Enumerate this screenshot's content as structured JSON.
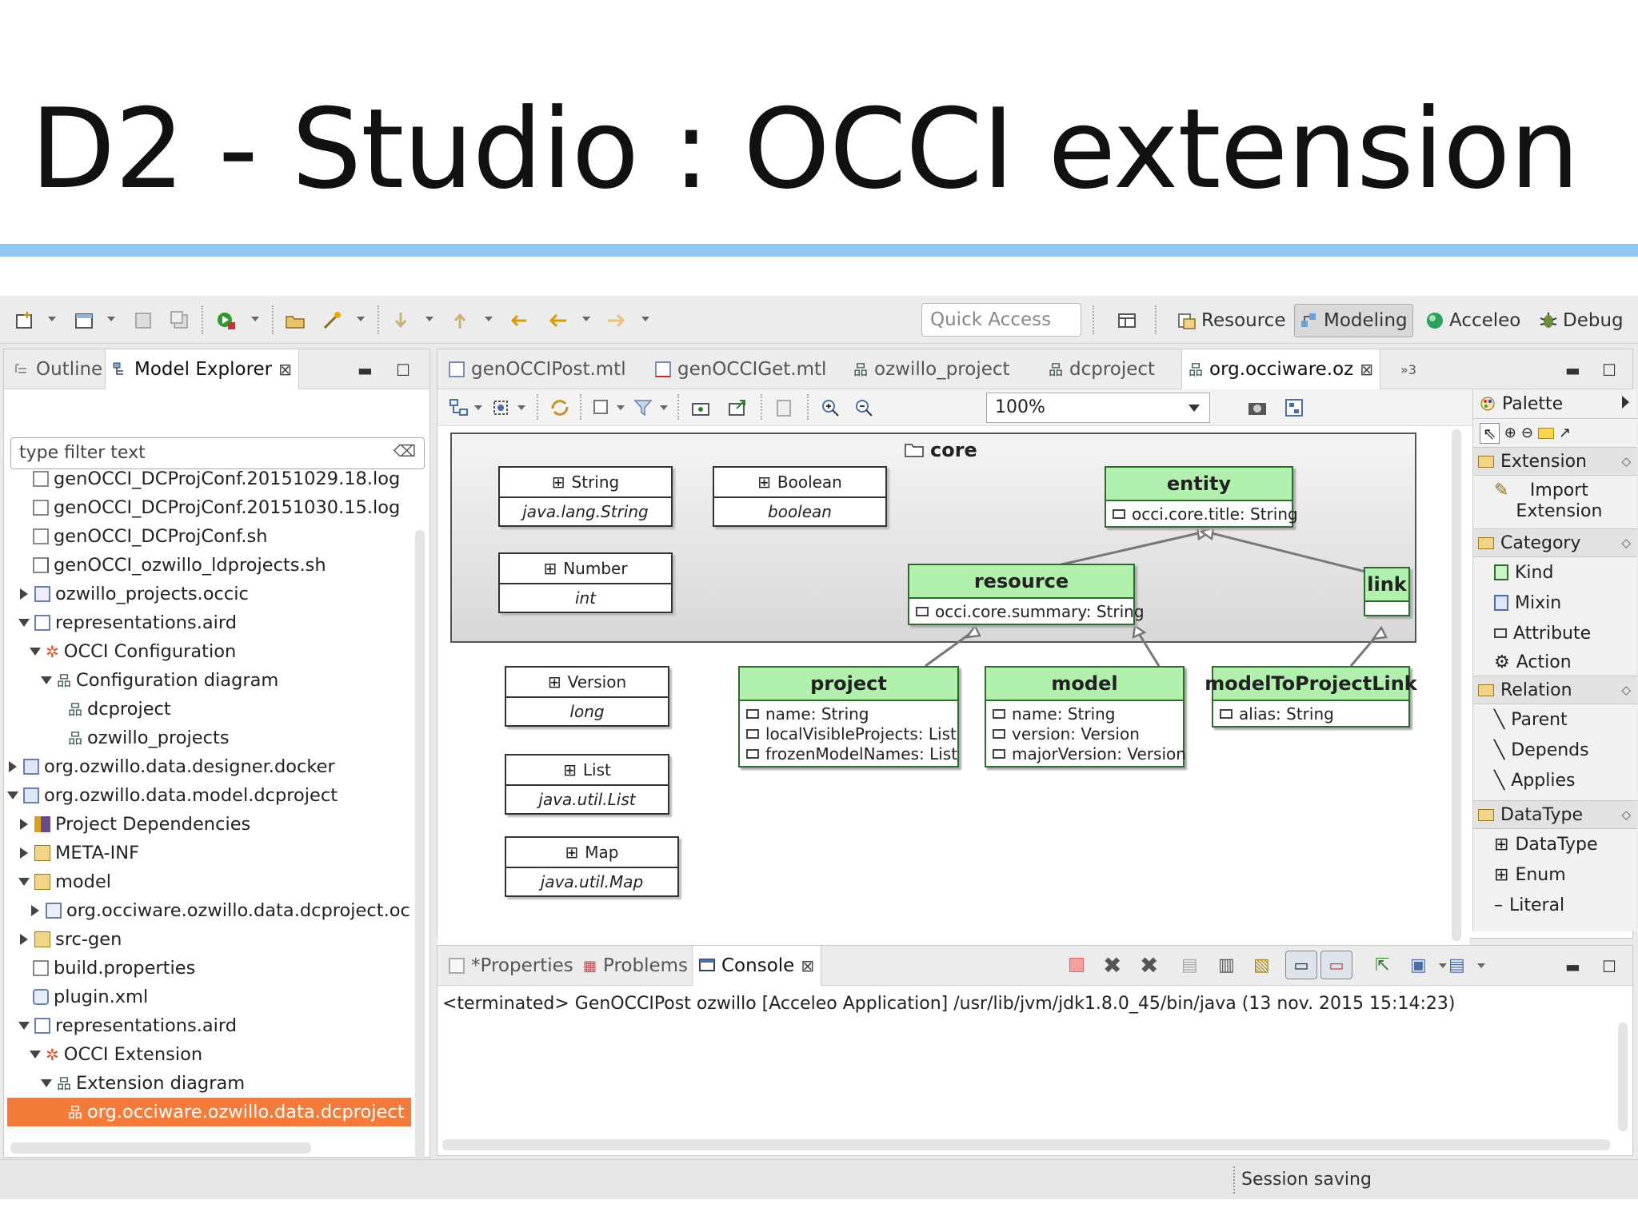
{
  "slide": {
    "title": "D2 - Studio : OCCI extension"
  },
  "toolbar": {
    "quick_access": "Quick Access",
    "perspectives": [
      {
        "label": "Resource"
      },
      {
        "label": "Modeling"
      },
      {
        "label": "Acceleo"
      },
      {
        "label": "Debug"
      }
    ]
  },
  "left_panel": {
    "tabs": [
      {
        "label": "Outline"
      },
      {
        "label": "Model Explorer"
      }
    ],
    "filter_placeholder": "type filter text",
    "tree": [
      {
        "label": "genOCCI_DCProjConf.20151029.18.log"
      },
      {
        "label": "genOCCI_DCProjConf.20151030.15.log"
      },
      {
        "label": "genOCCI_DCProjConf.sh"
      },
      {
        "label": "genOCCI_ozwillo_ldprojects.sh"
      },
      {
        "label": "ozwillo_projects.occic"
      },
      {
        "label": "representations.aird"
      },
      {
        "label": "OCCI Configuration"
      },
      {
        "label": "Configuration diagram"
      },
      {
        "label": "dcproject"
      },
      {
        "label": "ozwillo_projects"
      },
      {
        "label": "org.ozwillo.data.designer.docker"
      },
      {
        "label": "org.ozwillo.data.model.dcproject"
      },
      {
        "label": "Project Dependencies"
      },
      {
        "label": "META-INF"
      },
      {
        "label": "model"
      },
      {
        "label": "org.occiware.ozwillo.data.dcproject.occi"
      },
      {
        "label": "src-gen"
      },
      {
        "label": "build.properties"
      },
      {
        "label": "plugin.xml"
      },
      {
        "label": "representations.aird"
      },
      {
        "label": "OCCI Extension"
      },
      {
        "label": "Extension diagram"
      },
      {
        "label": "org.occiware.ozwillo.data.dcproject"
      }
    ]
  },
  "editor": {
    "tabs": [
      {
        "label": "genOCCIPost.mtl"
      },
      {
        "label": "genOCCIGet.mtl"
      },
      {
        "label": "ozwillo_project"
      },
      {
        "label": "dcproject"
      },
      {
        "label": "org.occiware.oz"
      },
      {
        "label": "»3"
      }
    ],
    "zoom": "100%",
    "diagram": {
      "container_title": "core",
      "datatypes": [
        {
          "name": "String",
          "type": "java.lang.String"
        },
        {
          "name": "Boolean",
          "type": "boolean"
        },
        {
          "name": "Number",
          "type": "int"
        },
        {
          "name": "Version",
          "type": "long"
        },
        {
          "name": "List",
          "type": "java.util.List"
        },
        {
          "name": "Map",
          "type": "java.util.Map"
        }
      ],
      "kinds": {
        "entity": {
          "name": "entity",
          "attrs": [
            "occi.core.title: String"
          ]
        },
        "resource": {
          "name": "resource",
          "attrs": [
            "occi.core.summary: String"
          ]
        },
        "link": {
          "name": "link",
          "attrs": []
        },
        "project": {
          "name": "project",
          "attrs": [
            "name: String",
            "localVisibleProjects: List",
            "frozenModelNames: List"
          ]
        },
        "model": {
          "name": "model",
          "attrs": [
            "name: String",
            "version: Version",
            "majorVersion: Version"
          ]
        },
        "modelToProjectLink": {
          "name": "modelToProjectLink",
          "attrs": [
            "alias: String"
          ]
        }
      }
    }
  },
  "palette": {
    "title": "Palette",
    "drawers": [
      {
        "label": "Extension",
        "items": [
          "Import Extension"
        ]
      },
      {
        "label": "Category",
        "items": [
          "Kind",
          "Mixin",
          "Attribute",
          "Action"
        ]
      },
      {
        "label": "Relation",
        "items": [
          "Parent",
          "Depends",
          "Applies"
        ]
      },
      {
        "label": "DataType",
        "items": [
          "DataType",
          "Enum",
          "Literal"
        ]
      }
    ]
  },
  "bottom_panel": {
    "tabs": [
      {
        "label": "*Properties"
      },
      {
        "label": "Problems"
      },
      {
        "label": "Console"
      }
    ],
    "console_line": "<terminated> GenOCCIPost ozwillo [Acceleo Application] /usr/lib/jvm/jdk1.8.0_45/bin/java (13 nov. 2015 15:14:23)"
  },
  "status": {
    "text": "Session saving"
  },
  "colors": {
    "accent_blue": "#8ec7f2",
    "selection": "#f47b3a",
    "kind_fill": "#c9f6c7"
  }
}
